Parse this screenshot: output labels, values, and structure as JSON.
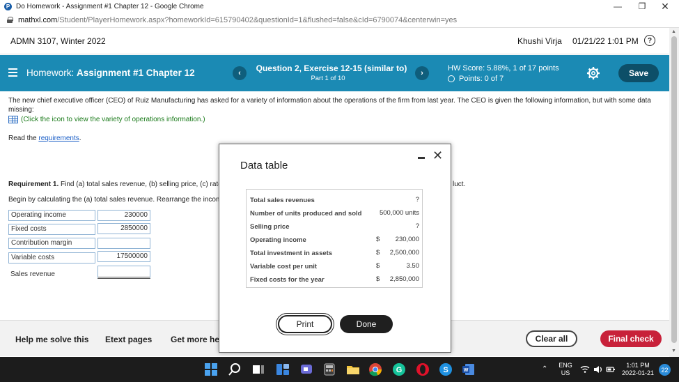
{
  "browser": {
    "window_title": "Do Homework - Assignment #1 Chapter 12 - Google Chrome",
    "favicon_letter": "P",
    "url_host": "mathxl.com",
    "url_rest": "/Student/PlayerHomework.aspx?homeworkId=615790402&questionId=1&flushed=false&cId=6790074&centerwin=yes"
  },
  "course": {
    "name": "ADMN 3107, Winter 2022",
    "user": "Khushi Virja",
    "datetime": "01/21/22 1:01 PM",
    "help_glyph": "?"
  },
  "hwbar": {
    "prefix": "Homework:",
    "title": "Assignment #1 Chapter 12",
    "prev_glyph": "‹",
    "next_glyph": "›",
    "question": "Question 2, Exercise 12-15 (similar to)",
    "part": "Part 1 of 10",
    "hw_score": "HW Score: 5.88%, 1 of 17 points",
    "points": "Points: 0 of 7",
    "save_label": "Save",
    "color": "#1b8ab4"
  },
  "content": {
    "intro": "The new chief executive officer (CEO) of Ruiz Manufacturing has asked for a variety of information about the operations of the firm from last year. The CEO is given the following information, but with some data missing:",
    "click_text": "(Click the icon to view the variety of operations information.)",
    "read_prefix": "Read the ",
    "read_link": "requirements",
    "read_suffix": ".",
    "req_label": "Requirement 1.",
    "req_text": " Find (a) total sales revenue, (b) selling price, (c) rate",
    "req_tail": "luct.",
    "begin_text": "Begin by calculating the (a) total sales revenue. Rearrange the incom",
    "rows": [
      {
        "label": "Operating income",
        "value": "230000"
      },
      {
        "label": "Fixed costs",
        "value": "2850000"
      },
      {
        "label": "Contribution margin",
        "value": ""
      },
      {
        "label": "Variable costs",
        "value": "17500000"
      },
      {
        "label": "Sales revenue",
        "value": ""
      }
    ]
  },
  "modal": {
    "title": "Data table",
    "rows": [
      {
        "label": "Total sales revenues",
        "currency": "",
        "value": "?"
      },
      {
        "label": "Number of units produced and sold",
        "currency": "",
        "value": "500,000 units"
      },
      {
        "label": "Selling price",
        "currency": "",
        "value": "?"
      },
      {
        "label": "Operating income",
        "currency": "$",
        "value": "230,000"
      },
      {
        "label": "Total investment in assets",
        "currency": "$",
        "value": "2,500,000"
      },
      {
        "label": "Variable cost per unit",
        "currency": "$",
        "value": "3.50"
      },
      {
        "label": "Fixed costs for the year",
        "currency": "$",
        "value": "2,850,000"
      }
    ],
    "print_label": "Print",
    "done_label": "Done"
  },
  "footer": {
    "help": "Help me solve this",
    "etext": "Etext pages",
    "more": "Get more he",
    "clear_all": "Clear all",
    "final_check": "Final check",
    "final_color": "#c8213a"
  },
  "taskbar": {
    "lang": "ENG",
    "region": "US",
    "time": "1:01 PM",
    "date": "2022-01-21",
    "notifications": "22"
  }
}
